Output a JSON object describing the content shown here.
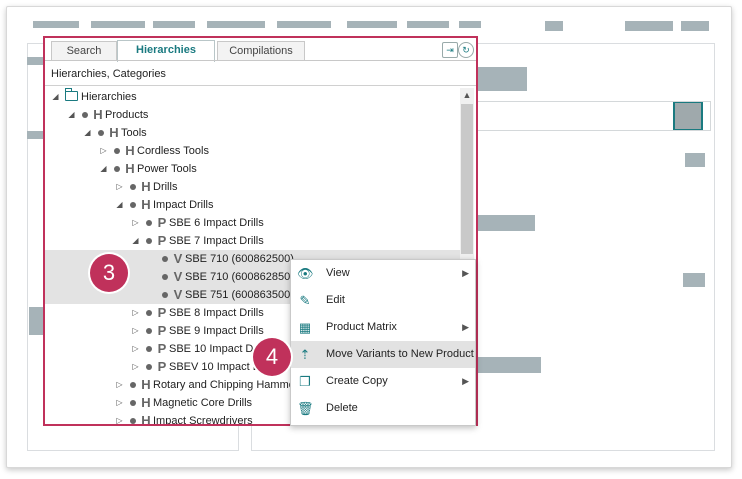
{
  "tabs": [
    {
      "label": "Search",
      "active": false
    },
    {
      "label": "Hierarchies",
      "active": true
    },
    {
      "label": "Compilations",
      "active": false
    }
  ],
  "breadcrumb": "Hierarchies, Categories",
  "tree": [
    {
      "label": "Hierarchies",
      "type": "folder",
      "toggle": "◢",
      "level": 0
    },
    {
      "label": "Products",
      "type": "H",
      "toggle": "◢",
      "level": 1
    },
    {
      "label": "Tools",
      "type": "H",
      "toggle": "◢",
      "level": 2
    },
    {
      "label": "Cordless Tools",
      "type": "H",
      "toggle": "▷",
      "level": 3
    },
    {
      "label": "Power Tools",
      "type": "H",
      "toggle": "◢",
      "level": 3
    },
    {
      "label": "Drills",
      "type": "H",
      "toggle": "▷",
      "level": 4
    },
    {
      "label": "Impact Drills",
      "type": "H",
      "toggle": "◢",
      "level": 4
    },
    {
      "label": "SBE 6 Impact Drills",
      "type": "P",
      "toggle": "▷",
      "level": 5
    },
    {
      "label": "SBE 7 Impact Drills",
      "type": "P",
      "toggle": "◢",
      "level": 5
    },
    {
      "label": "SBE 710 (600862500)",
      "type": "V",
      "toggle": "",
      "level": 6,
      "selected": true
    },
    {
      "label": "SBE 710 (600862850)",
      "type": "V",
      "toggle": "",
      "level": 6,
      "selected": true
    },
    {
      "label": "SBE 751 (600863500)",
      "type": "V",
      "toggle": "",
      "level": 6,
      "selected": true
    },
    {
      "label": "SBE 8 Impact Drills",
      "type": "P",
      "toggle": "▷",
      "level": 5
    },
    {
      "label": "SBE 9 Impact Drills",
      "type": "P",
      "toggle": "▷",
      "level": 5
    },
    {
      "label": "SBE 10 Impact Drills",
      "type": "P",
      "toggle": "▷",
      "level": 5
    },
    {
      "label": "SBEV 10 Impact Drills",
      "type": "P",
      "toggle": "▷",
      "level": 5
    },
    {
      "label": "Rotary and Chipping Hammers",
      "type": "H",
      "toggle": "▷",
      "level": 4
    },
    {
      "label": "Magnetic Core Drills",
      "type": "H",
      "toggle": "▷",
      "level": 4
    },
    {
      "label": "Impact Screwdrivers",
      "type": "H",
      "toggle": "▷",
      "level": 4
    }
  ],
  "menu": [
    {
      "label": "View",
      "icon": "eye-icon",
      "glyph": "👁",
      "submenu": true,
      "highlighted": false
    },
    {
      "label": "Edit",
      "icon": "pencil-icon",
      "glyph": "✎",
      "submenu": false,
      "highlighted": false
    },
    {
      "label": "Product Matrix",
      "icon": "grid-icon",
      "glyph": "▦",
      "submenu": true,
      "highlighted": false
    },
    {
      "label": "Move Variants to New Product",
      "icon": "move-variants-icon",
      "glyph": "⇡",
      "submenu": false,
      "highlighted": true
    },
    {
      "label": "Create Copy",
      "icon": "copy-icon",
      "glyph": "❐",
      "submenu": true,
      "highlighted": false
    },
    {
      "label": "Delete",
      "icon": "trash-icon",
      "glyph": "🗑",
      "submenu": false,
      "highlighted": false
    }
  ],
  "badges": {
    "step3": "3",
    "step4": "4"
  },
  "colors": {
    "accent": "#1a7a80",
    "highlight": "#c0315b"
  }
}
